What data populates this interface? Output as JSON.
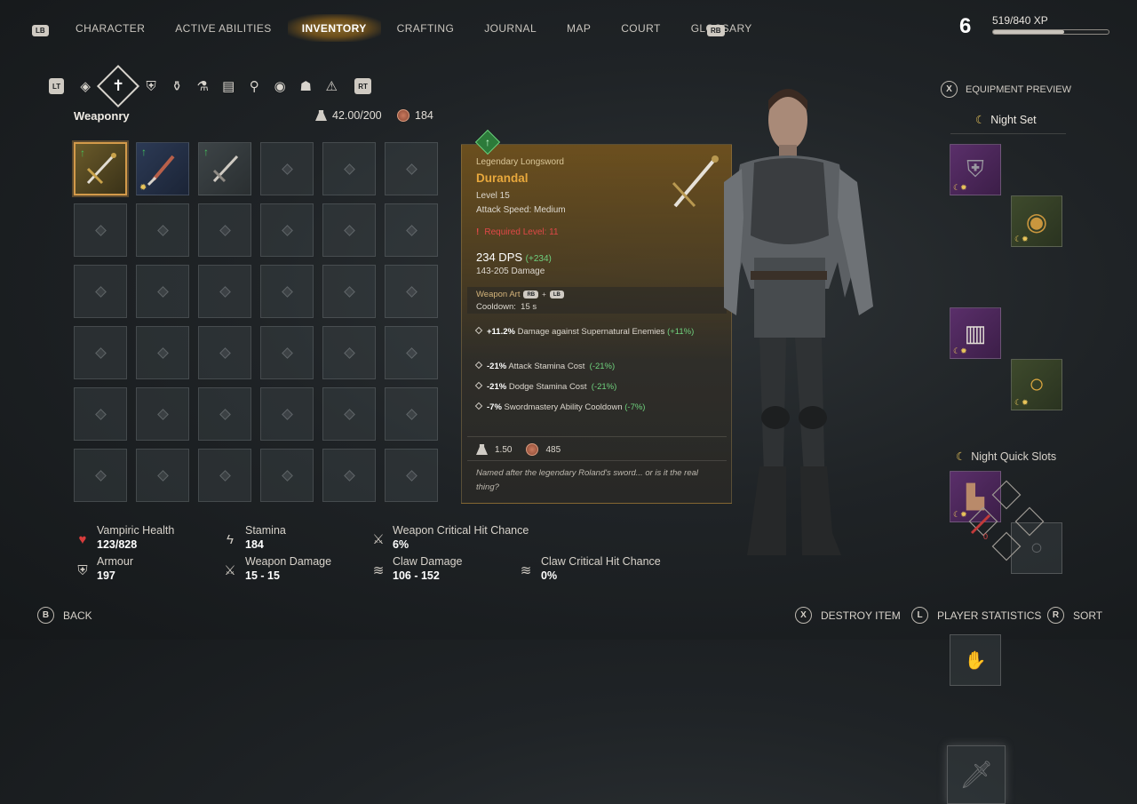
{
  "nav": {
    "left_bumper": "LB",
    "right_bumper": "RB",
    "tabs": [
      "CHARACTER",
      "ACTIVE ABILITIES",
      "INVENTORY",
      "CRAFTING",
      "JOURNAL",
      "MAP",
      "COURT",
      "GLOSSARY"
    ],
    "active_tab": "INVENTORY"
  },
  "player": {
    "level": "6",
    "xp_text": "519/840 XP",
    "xp_fraction": 0.618
  },
  "category_bar": {
    "left_trigger": "LT",
    "right_trigger": "RT",
    "icons": [
      "all-items-icon",
      "weapon-icon",
      "armor-icon",
      "potion-icon",
      "flask-icon",
      "book-icon",
      "mortar-icon",
      "bomb-icon",
      "helmet-icon",
      "alert-icon"
    ]
  },
  "inventory": {
    "title": "Weaponry",
    "weight": "42.00/200",
    "money": "184",
    "items": [
      {
        "type": "longsword",
        "selected": true,
        "upgrade": true,
        "rarity": "legendary"
      },
      {
        "type": "blade",
        "selected": false,
        "upgrade": true,
        "rarity": "rare",
        "night": true
      },
      {
        "type": "sword",
        "selected": false,
        "upgrade": true,
        "rarity": "common"
      }
    ]
  },
  "tooltip": {
    "type": "Legendary Longsword",
    "name": "Durandal",
    "level": "Level 15",
    "attack_speed": "Attack Speed: Medium",
    "required": "Required Level: 11",
    "dps": "234 DPS",
    "dps_delta": "(+234)",
    "damage": "143-205 Damage",
    "weapon_art": "Weapon Art",
    "art_buttons": [
      "RB",
      "+",
      "LB"
    ],
    "cooldown_label": "Cooldown:",
    "cooldown_value": "15 s",
    "stats": [
      {
        "bold": "+11.2%",
        "text": "Damage against Supernatural Enemies",
        "delta": "(+11%)"
      },
      {
        "bold": "-21%",
        "text": "Attack Stamina Cost",
        "delta": "(-21%)"
      },
      {
        "bold": "-21%",
        "text": "Dodge Stamina Cost",
        "delta": "(-21%)"
      },
      {
        "bold": "-7%",
        "text": "Swordmastery Ability Cooldown",
        "delta": "(-7%)"
      }
    ],
    "weight": "1.50",
    "price": "485",
    "lore": "Named after the legendary Roland's sword... or is it the real thing?"
  },
  "equipment": {
    "preview_button": "X",
    "preview_label": "EQUIPMENT PREVIEW",
    "set_name": "Night Set",
    "quick_slots_label": "Night Quick Slots",
    "quick_count": "0"
  },
  "stats": {
    "vampiric_health": {
      "label": "Vampiric Health",
      "value": "123/828"
    },
    "armour": {
      "label": "Armour",
      "value": "197"
    },
    "stamina": {
      "label": "Stamina",
      "value": "184"
    },
    "weapon_damage": {
      "label": "Weapon Damage",
      "value": "15 - 15"
    },
    "weapon_crit": {
      "label": "Weapon Critical Hit Chance",
      "value": "6%"
    },
    "claw_damage": {
      "label": "Claw Damage",
      "value": "106 - 152"
    },
    "claw_crit": {
      "label": "Claw Critical Hit Chance",
      "value": "0%"
    }
  },
  "bottom_bar": {
    "back_key": "B",
    "back_label": "BACK",
    "destroy_key": "X",
    "destroy_label": "DESTROY ITEM",
    "stats_key": "L",
    "stats_label": "PLAYER STATISTICS",
    "sort_key": "R",
    "sort_label": "SORT"
  },
  "colors": {
    "accent_orange": "#e8a83c",
    "upgrade_green": "#44c25c",
    "warning_red": "#e04848",
    "night_purple": "#5a2f6a"
  }
}
